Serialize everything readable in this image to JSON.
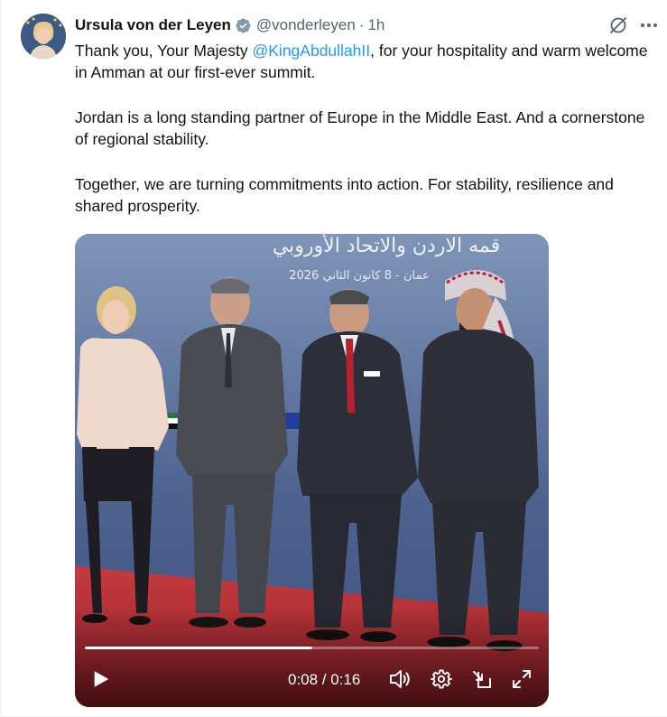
{
  "author": {
    "display_name": "Ursula von der Leyen",
    "handle": "@vonderleyen",
    "separator": "·",
    "time": "1h",
    "verified": true
  },
  "icons": {
    "verified": "verified-badge-icon",
    "grok": "grok-icon",
    "more": "more-icon",
    "play": "play-icon",
    "volume": "volume-icon",
    "settings": "gear-icon",
    "pip": "picture-in-picture-icon",
    "fullscreen": "fullscreen-icon"
  },
  "post": {
    "p1_before": "Thank you, Your Majesty ",
    "p1_mention": "@KingAbdullahII",
    "p1_after": ", for your hospitality and warm welcome in Amman at our first-ever summit.",
    "p2": "Jordan is a long standing partner of Europe in the Middle East. And a cornerstone of regional stability.",
    "p3": "Together, we are turning commitments into action. For stability, resilience and shared prosperity."
  },
  "video": {
    "backdrop_title": "قمه الاردن والاتحاد الأوروبي",
    "backdrop_subtitle": "عمان - 8 كانون الثاني 2026",
    "time_display": "0:08 / 0:16",
    "progress_fraction": 0.5
  },
  "colors": {
    "link": "#1d9bf0",
    "verified": "#829aab",
    "secondary_text": "#536471",
    "carpet": "#c2323a",
    "backdrop": "#5d6f93"
  }
}
